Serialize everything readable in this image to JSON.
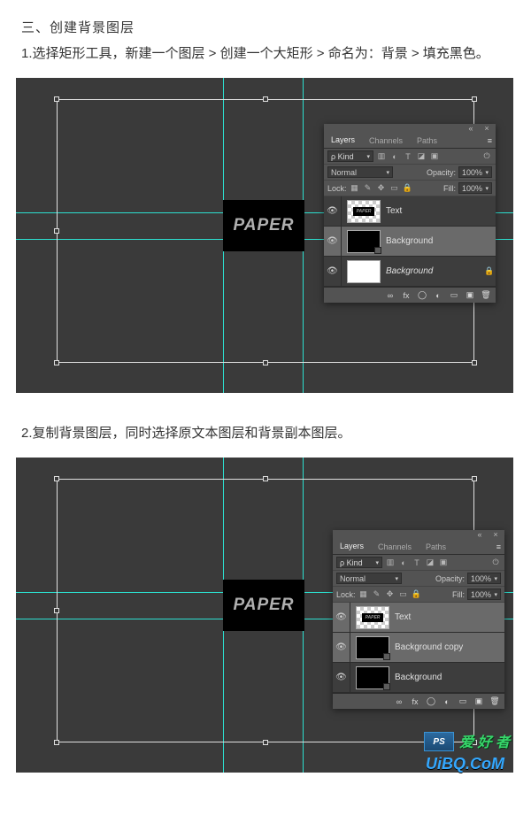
{
  "article": {
    "section_title": "三、创建背景图层",
    "step1": "1.选择矩形工具，新建一个图层 > 创建一个大矩形 > 命名为：背景 > 填充黑色。",
    "step2": "2.复制背景图层，同时选择原文本图层和背景副本图层。"
  },
  "canvas": {
    "paper_text": "PAPER",
    "guide_color": "#2ce0d0"
  },
  "panel_common": {
    "tabs": {
      "layers": "Layers",
      "channels": "Channels",
      "paths": "Paths"
    },
    "kind_label": "Kind",
    "blend_mode": "Normal",
    "opacity_label": "Opacity:",
    "opacity_value": "100%",
    "lock_label": "Lock:",
    "fill_label": "Fill:",
    "fill_value": "100%",
    "link_label": "∞",
    "fx_label": "fx"
  },
  "panel1": {
    "layers": [
      {
        "name": "Text",
        "type": "text-paper",
        "selected": false
      },
      {
        "name": "Background",
        "type": "black",
        "selected": true
      },
      {
        "name": "Background",
        "type": "white",
        "selected": false,
        "locked": true
      }
    ]
  },
  "panel2": {
    "layers": [
      {
        "name": "Text",
        "type": "text-paper",
        "selected": true
      },
      {
        "name": "Background copy",
        "type": "black",
        "selected": true
      },
      {
        "name": "Background",
        "type": "black",
        "selected": false
      }
    ]
  },
  "watermark": {
    "logo_text": "PS",
    "cn_text": "爱 好 者",
    "url_text": "UiBQ.CoM"
  }
}
